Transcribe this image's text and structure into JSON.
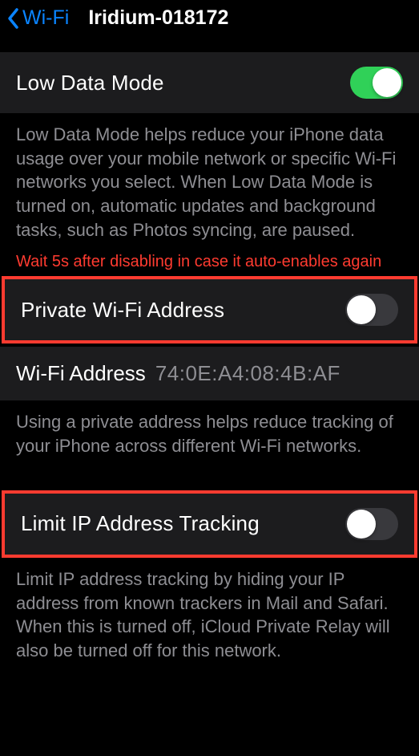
{
  "header": {
    "back_label": "Wi-Fi",
    "title": "Iridium-018172"
  },
  "low_data_mode": {
    "label": "Low Data Mode",
    "enabled": true,
    "description": "Low Data Mode helps reduce your iPhone data usage over your mobile network or specific Wi-Fi networks you select. When Low Data Mode is turned on, automatic updates and background tasks, such as Photos syncing, are paused."
  },
  "annotation_private": "Wait 5s after disabling in case it auto-enables again",
  "private_wifi_address": {
    "label": "Private Wi-Fi Address",
    "enabled": false
  },
  "wifi_address": {
    "label": "Wi-Fi Address",
    "value": "74:0E:A4:08:4B:AF"
  },
  "private_wifi_description": "Using a private address helps reduce tracking of your iPhone across different Wi-Fi networks.",
  "limit_ip_tracking": {
    "label": "Limit IP Address Tracking",
    "enabled": false,
    "description": "Limit IP address tracking by hiding your IP address from known trackers in Mail and Safari. When this is turned off, iCloud Private Relay will also be turned off for this network."
  }
}
